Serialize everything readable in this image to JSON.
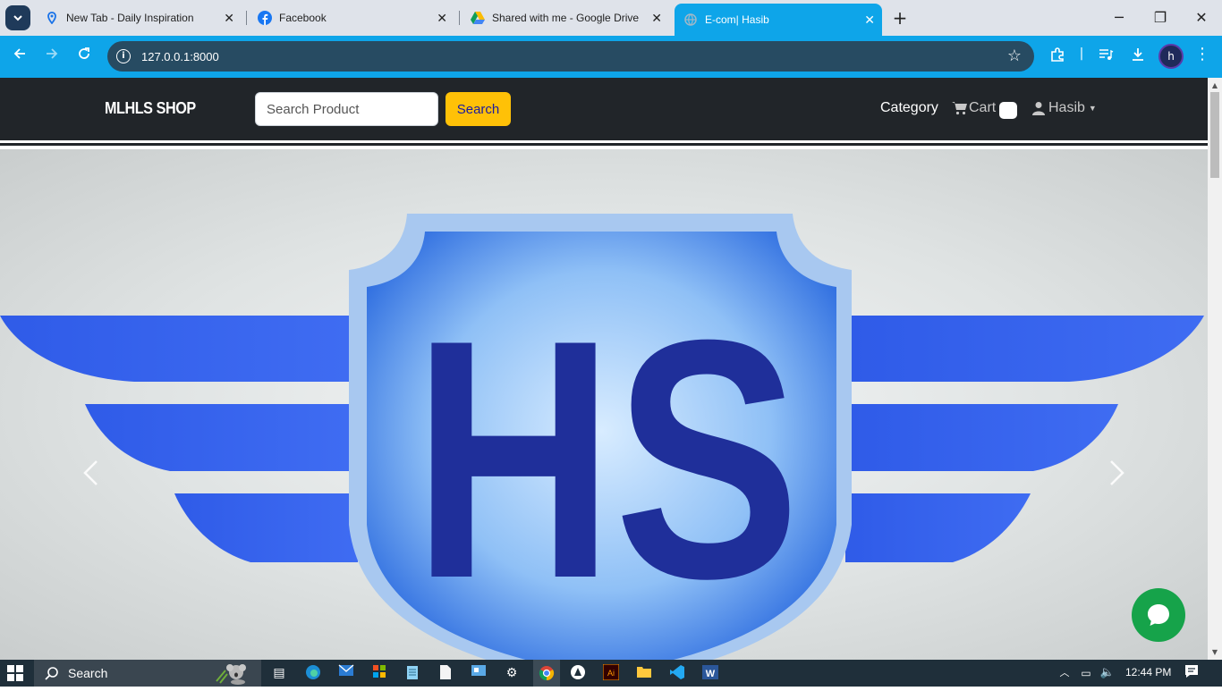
{
  "browser": {
    "tabs": [
      {
        "title": "New Tab - Daily Inspiration",
        "icon": "location-pin-icon",
        "active": false
      },
      {
        "title": "Facebook",
        "icon": "facebook-icon",
        "active": false
      },
      {
        "title": "Shared with me - Google Drive",
        "icon": "google-drive-icon",
        "active": false
      },
      {
        "title": "E-com| Hasib",
        "icon": "globe-icon",
        "active": true
      }
    ],
    "url": "127.0.0.1:8000",
    "profile_initial": "h"
  },
  "site": {
    "brand": "MLHLS SHOP",
    "search": {
      "placeholder": "Search Product",
      "button_label": "Search"
    },
    "nav": {
      "category": "Category",
      "cart": "Cart",
      "user": "Hasib"
    },
    "hero": {
      "logo_text": "HS"
    }
  },
  "taskbar": {
    "search_label": "Search",
    "clock": "12:44 PM"
  },
  "colors": {
    "accent": "#0ea5e9",
    "navbar": "#212529",
    "search_button": "#ffc107",
    "chat": "#16a34a",
    "logo_blue": "#1f2f9a"
  }
}
